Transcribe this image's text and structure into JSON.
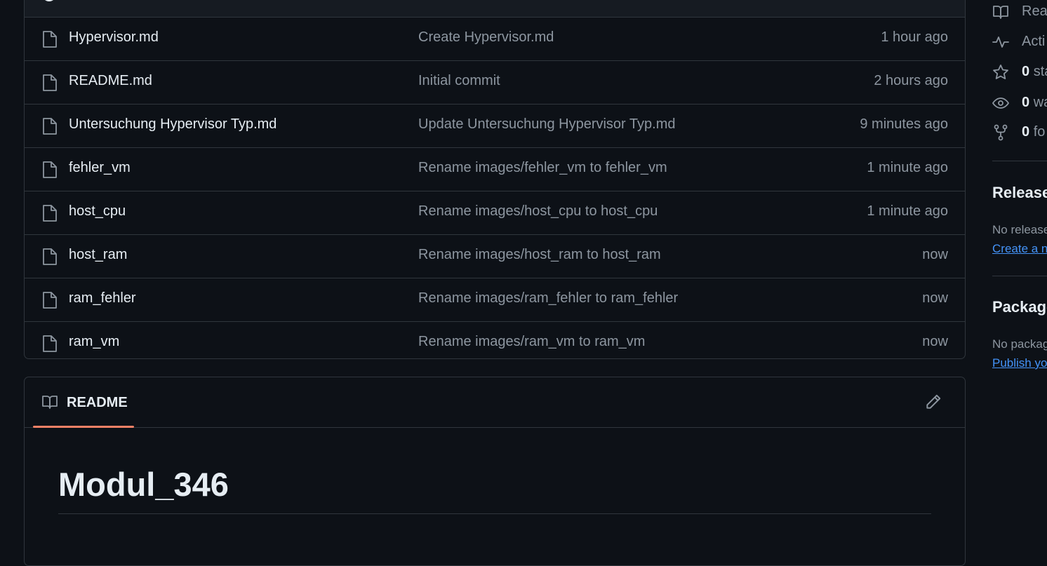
{
  "files": [
    {
      "name": "Hypervisor.md",
      "commit": "Create Hypervisor.md",
      "time": "1 hour ago"
    },
    {
      "name": "README.md",
      "commit": "Initial commit",
      "time": "2 hours ago"
    },
    {
      "name": "Untersuchung Hypervisor Typ.md",
      "commit": "Update Untersuchung Hypervisor Typ.md",
      "time": "9 minutes ago"
    },
    {
      "name": "fehler_vm",
      "commit": "Rename images/fehler_vm to fehler_vm",
      "time": "1 minute ago"
    },
    {
      "name": "host_cpu",
      "commit": "Rename images/host_cpu to host_cpu",
      "time": "1 minute ago"
    },
    {
      "name": "host_ram",
      "commit": "Rename images/host_ram to host_ram",
      "time": "now"
    },
    {
      "name": "ram_fehler",
      "commit": "Rename images/ram_fehler to ram_fehler",
      "time": "now"
    },
    {
      "name": "ram_vm",
      "commit": "Rename images/ram_vm to ram_vm",
      "time": "now"
    }
  ],
  "readme": {
    "tab_label": "README",
    "title": "Modul_346"
  },
  "sidebar": {
    "readme_link": "Read",
    "activity_link": "Acti",
    "stars_count": "0",
    "stars_label": "sta",
    "watchers_count": "0",
    "watchers_label": "wa",
    "forks_count": "0",
    "forks_label": "fo",
    "releases_heading": "Releases",
    "releases_empty": "No releases",
    "releases_create": "Create a n",
    "packages_heading": "Packages",
    "packages_empty": "No packages",
    "packages_publish": "Publish yo"
  },
  "colors": {
    "background": "#0d1117",
    "border": "#30363d",
    "muted_text": "#8d96a0",
    "link": "#4493f8",
    "tab_underline": "#f78166"
  }
}
